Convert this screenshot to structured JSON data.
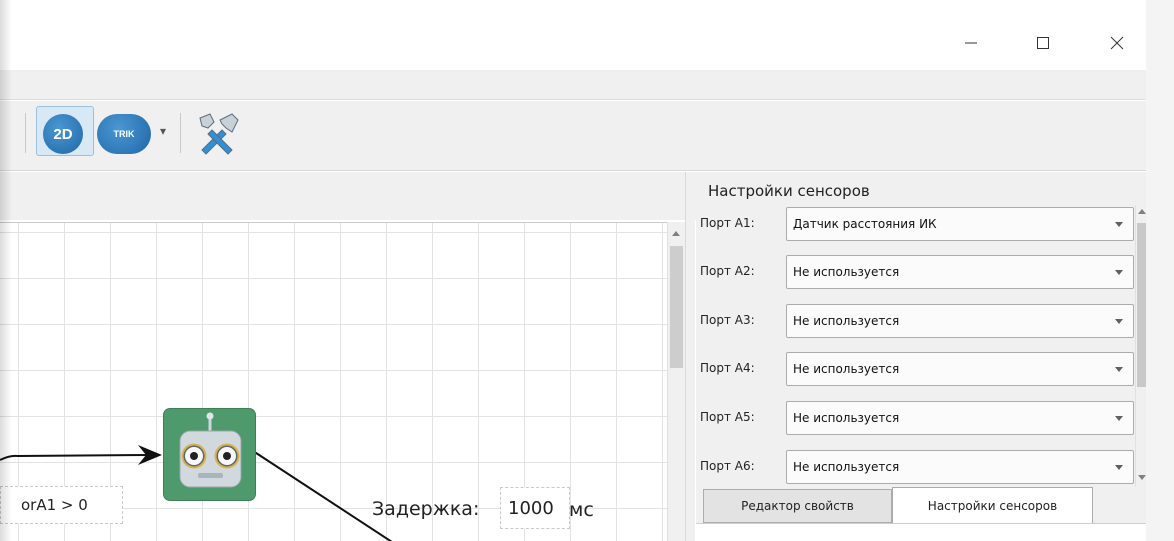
{
  "window": {
    "controls": {
      "minimize": "—",
      "maximize": "☐",
      "close": "✕"
    }
  },
  "toolbar": {
    "mode_2d_label": "2D",
    "trik_label": "TRIK",
    "dropdown_arrow": "▾",
    "tools_icon": "tools-icon"
  },
  "scene": {
    "condition_text": "orA1 > 0",
    "delay": {
      "label": "Задержка:",
      "value": "1000",
      "unit": "мс"
    }
  },
  "sensors_panel": {
    "title": "Настройки сенсоров",
    "ports": [
      {
        "label": "Порт A1:",
        "value": "Датчик расстояния ИК"
      },
      {
        "label": "Порт A2:",
        "value": "Не используется"
      },
      {
        "label": "Порт A3:",
        "value": "Не используется"
      },
      {
        "label": "Порт A4:",
        "value": "Не используется"
      },
      {
        "label": "Порт A5:",
        "value": "Не используется"
      },
      {
        "label": "Порт A6:",
        "value": "Не используется"
      }
    ],
    "tabs": [
      {
        "label": "Редактор свойств",
        "active": false
      },
      {
        "label": "Настройки сенсоров",
        "active": true
      }
    ]
  },
  "colors": {
    "accent_blue": "#2b7bbd",
    "robot_green": "#4f9a6c",
    "panel_bg": "#f0f0f0"
  }
}
